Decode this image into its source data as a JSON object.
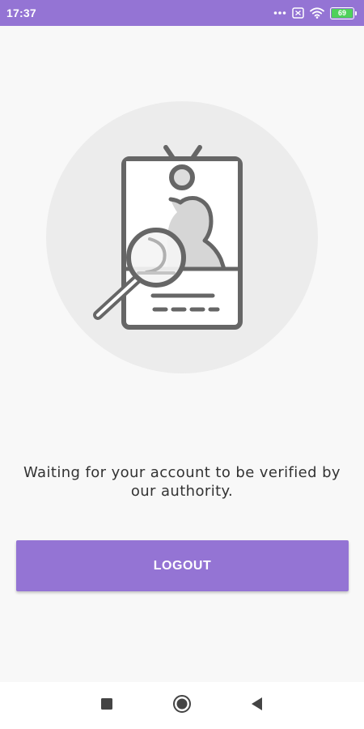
{
  "status_bar": {
    "time": "17:37",
    "battery_level": "69",
    "icons": [
      "dots-icon",
      "sim-icon",
      "wifi-icon",
      "battery-icon"
    ],
    "background_color": "#9474d4"
  },
  "illustration": {
    "icon": "id-badge-search-icon",
    "circle_color": "#ececec"
  },
  "message": {
    "text": "Waiting for your account to be verified by our authority."
  },
  "logout_button": {
    "label": "LOGOUT",
    "color": "#9474d4"
  },
  "nav_bar": {
    "items": [
      "recents-icon",
      "home-icon",
      "back-icon"
    ]
  }
}
